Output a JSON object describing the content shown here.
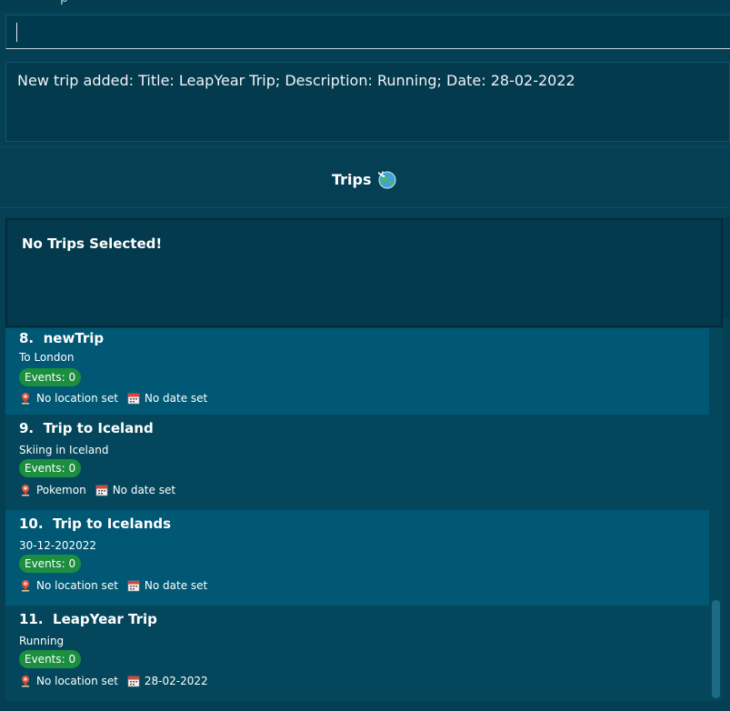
{
  "command": {
    "value": "",
    "partial_top_text": "p"
  },
  "result": {
    "message": "New trip added: Title: LeapYear Trip; Description: Running; Date: 28-02-2022"
  },
  "trips_header": {
    "title": "Trips",
    "icon": "globe-airplane-icon"
  },
  "selected": {
    "message": "No Trips Selected!"
  },
  "trips": [
    {
      "index": "8.",
      "title": "newTrip",
      "description": "To London",
      "events": "Events: 0",
      "location": "No location set",
      "date": "No date set"
    },
    {
      "index": "9.",
      "title": "Trip to Iceland",
      "description": "Skiing in Iceland",
      "events": "Events: 0",
      "location": "Pokemon",
      "date": "No date set"
    },
    {
      "index": "10.",
      "title": "Trip to Icelands",
      "description": "30-12-202022",
      "events": "Events: 0",
      "location": "No location set",
      "date": "No date set"
    },
    {
      "index": "11.",
      "title": "LeapYear Trip",
      "description": "Running",
      "events": "Events: 0",
      "location": "No location set",
      "date": "28-02-2022"
    }
  ],
  "colors": {
    "background": "#043f54",
    "card_highlight": "#005874",
    "card_normal": "#04475c",
    "badge_green": "#1b8f3f"
  }
}
